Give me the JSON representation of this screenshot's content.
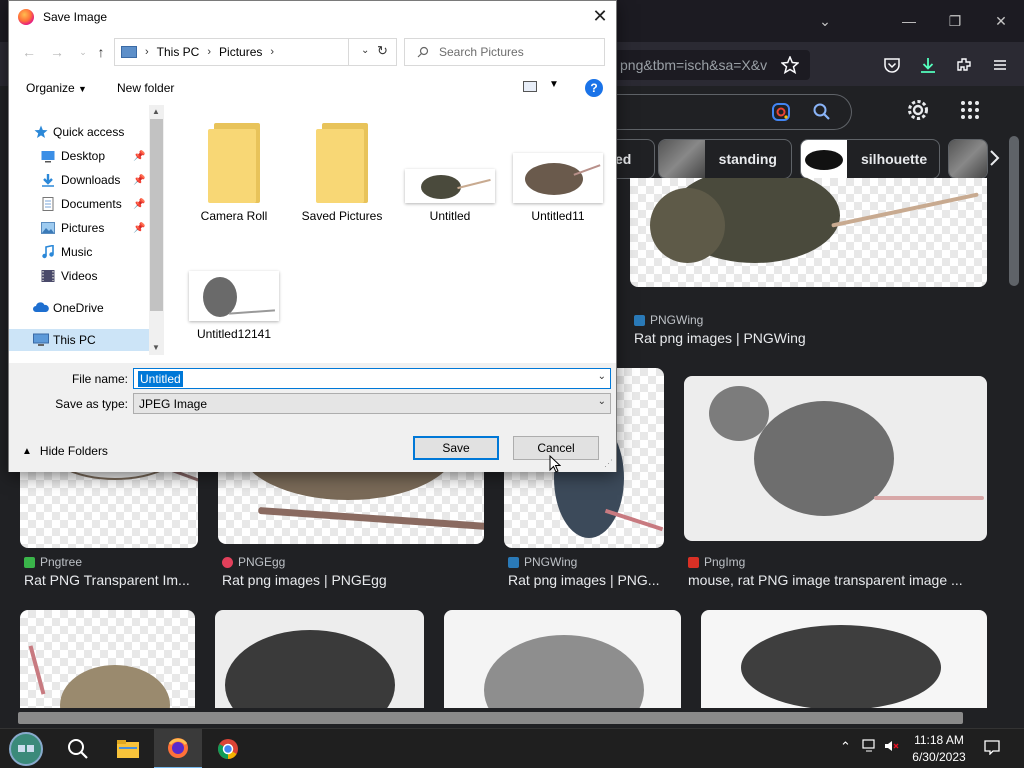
{
  "browser": {
    "url_fragment": "png&tbm=isch&sa=X&v",
    "chips": [
      {
        "label": "ed"
      },
      {
        "label": "standing"
      },
      {
        "label": "silhouette"
      }
    ]
  },
  "results": [
    {
      "source": "PNGWing",
      "title": "Rat png images | PNGWing",
      "source_color": "#2a7ab8"
    },
    {
      "source": "Pngtree",
      "title": "Rat PNG Transparent Im...",
      "source_color": "#3ab54a"
    },
    {
      "source": "PNGEgg",
      "title": "Rat png images | PNGEgg",
      "source_color": "#e2405b"
    },
    {
      "source": "PNGWing",
      "title": "Rat png images | PNG...",
      "source_color": "#2a7ab8"
    },
    {
      "source": "PngImg",
      "title": "mouse, rat PNG image transparent image ...",
      "source_color": "#d93025"
    }
  ],
  "dialog": {
    "title": "Save Image",
    "breadcrumb": [
      "This PC",
      "Pictures"
    ],
    "search_placeholder": "Search Pictures",
    "toolbar": {
      "organize": "Organize",
      "new_folder": "New folder",
      "help": "?"
    },
    "nav": [
      {
        "label": "Quick access"
      },
      {
        "label": "Desktop"
      },
      {
        "label": "Downloads"
      },
      {
        "label": "Documents"
      },
      {
        "label": "Pictures"
      },
      {
        "label": "Music"
      },
      {
        "label": "Videos"
      },
      {
        "label": "OneDrive"
      },
      {
        "label": "This PC"
      }
    ],
    "files": [
      {
        "name": "Camera Roll"
      },
      {
        "name": "Saved Pictures"
      },
      {
        "name": "Untitled"
      },
      {
        "name": "Untitled11"
      },
      {
        "name": "Untitled12141"
      }
    ],
    "file_name_label": "File name:",
    "file_name_value": "Untitled",
    "save_type_label": "Save as type:",
    "save_type_value": "JPEG Image",
    "hide_folders": "Hide Folders",
    "save_label": "Save",
    "cancel_label": "Cancel"
  },
  "taskbar": {
    "time": "11:18 AM",
    "date": "6/30/2023"
  },
  "colors": {
    "accent": "#0078d7",
    "browser_bg": "#202124",
    "folder": "#f8d775"
  }
}
